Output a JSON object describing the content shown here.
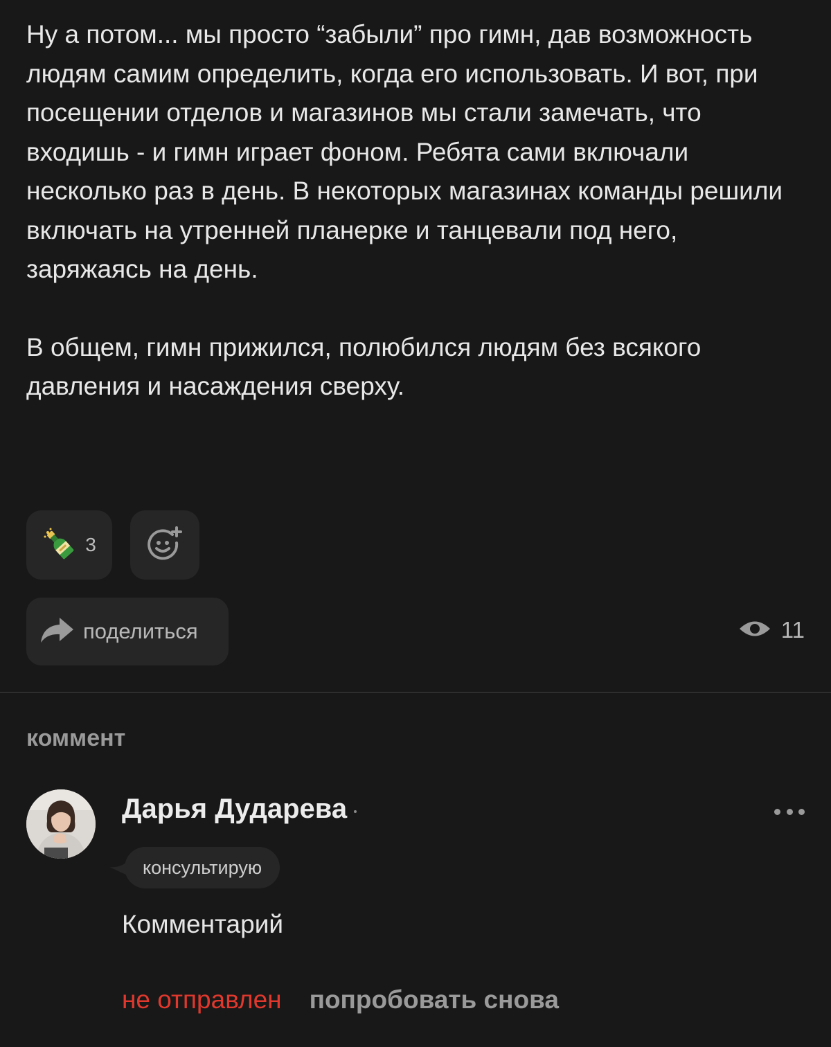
{
  "article": {
    "paragraphs": [
      "Ну а потом... мы просто “забыли” про гимн, дав возможность людям самим определить, когда его использовать. И вот, при посещении отделов и магазинов мы стали замечать, что входишь - и гимн играет фоном. Ребята сами включали несколько раз в день. В некоторых магазинах команды решили включать на утренней планерке и танцевали под него, заряжаясь на день.",
      "В общем, гимн прижился, полюбился людям без всякого давления и насаждения сверху."
    ]
  },
  "reactions": {
    "items": [
      {
        "icon": "champagne-bottle-icon",
        "count": "3"
      }
    ],
    "add_icon": "add-reaction-icon"
  },
  "share": {
    "label": "поделиться",
    "icon": "share-arrow-icon"
  },
  "views": {
    "icon": "eye-icon",
    "count": "11"
  },
  "comments": {
    "heading": "коммент",
    "items": [
      {
        "author": "Дарья Дударева",
        "badge": "консультирую",
        "text": "Комментарий",
        "status": "не отправлен",
        "retry_label": "попробовать снова"
      }
    ]
  },
  "colors": {
    "background": "#181818",
    "chip": "#262626",
    "error": "#e0382d",
    "muted": "#9a9a9a"
  }
}
